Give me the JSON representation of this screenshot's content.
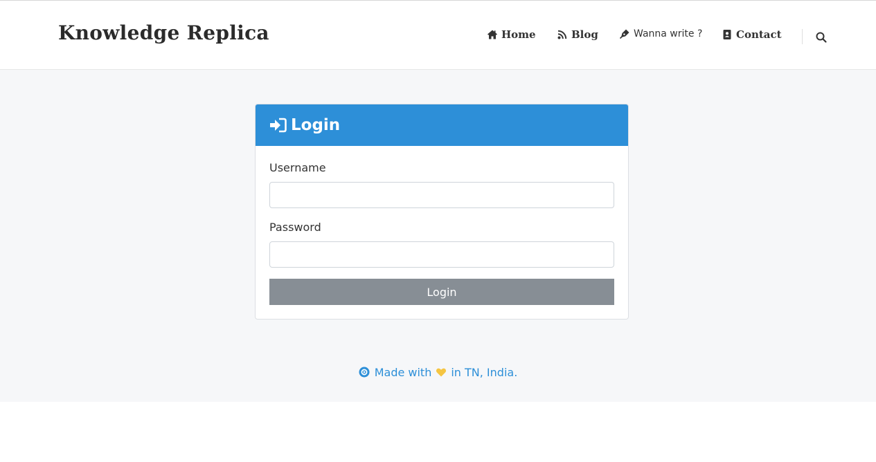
{
  "header": {
    "brand": "Knowledge Replica",
    "nav": [
      {
        "label": "Home",
        "icon": "home-icon"
      },
      {
        "label": "Blog",
        "icon": "rss-icon"
      },
      {
        "label": "Wanna write ?",
        "icon": "pen-nib-icon"
      },
      {
        "label": "Contact",
        "icon": "address-book-icon"
      }
    ],
    "search_icon": "search-icon"
  },
  "login_card": {
    "title": "Login",
    "title_icon": "sign-in-icon",
    "username_label": "Username",
    "username_value": "",
    "password_label": "Password",
    "password_value": "",
    "submit_label": "Login"
  },
  "footer": {
    "prefix": "Made with",
    "suffix": "in TN, India.",
    "heart_icon": "heart-icon",
    "lead_icon": "circle-arrow-icon"
  },
  "colors": {
    "accent": "#2d8fd8",
    "button": "#878e95",
    "page_bg": "#f6f7f9",
    "heart": "#f5c542"
  }
}
